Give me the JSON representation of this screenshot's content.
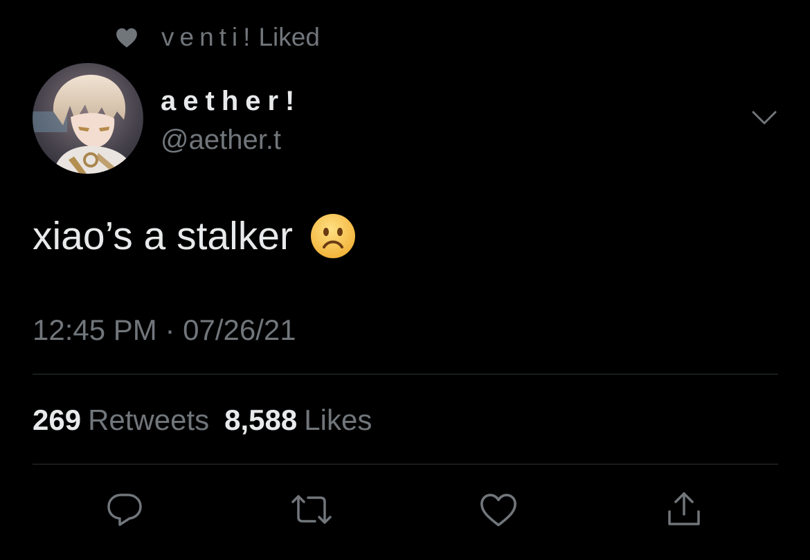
{
  "social_context": {
    "icon": "heart-icon",
    "liker_name": "venti!",
    "action_label": "Liked"
  },
  "tweet": {
    "display_name": "aether!",
    "handle": "@aether.t",
    "text": "xiao’s a stalker",
    "emoji": "frowning-face-emoji",
    "time": "12:45 PM",
    "separator": "·",
    "date": "07/26/21"
  },
  "stats": {
    "retweets_count": "269",
    "retweets_label": "Retweets",
    "likes_count": "8,588",
    "likes_label": "Likes"
  },
  "actions": [
    {
      "name": "reply",
      "icon": "reply-icon"
    },
    {
      "name": "retweet",
      "icon": "retweet-icon"
    },
    {
      "name": "like",
      "icon": "heart-icon"
    },
    {
      "name": "share",
      "icon": "share-icon"
    }
  ],
  "colors": {
    "background": "#000000",
    "primary_text": "#e7e9ea",
    "secondary_text": "#71767b",
    "divider": "#2f3336",
    "emoji_face": "#f7c045"
  }
}
